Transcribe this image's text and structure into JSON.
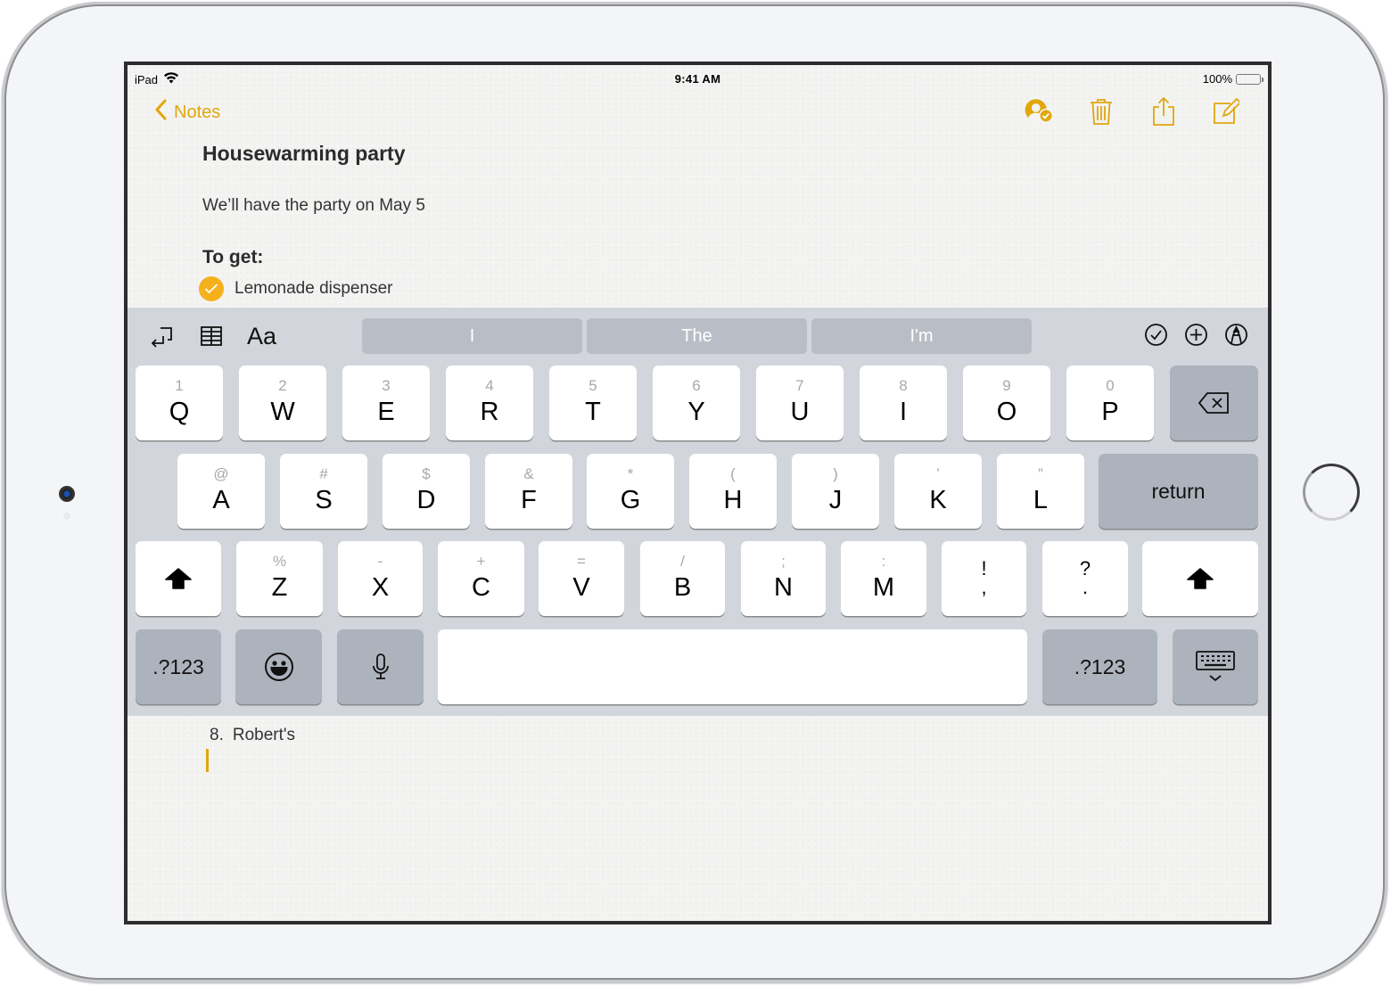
{
  "status_bar": {
    "device": "iPad",
    "time": "9:41 AM",
    "battery": "100%",
    "battery_level": 1.0
  },
  "nav": {
    "back_label": "Notes",
    "icons": [
      "collaborator-icon",
      "trash-icon",
      "share-icon",
      "compose-icon"
    ]
  },
  "note": {
    "title": "Housewarming party",
    "body": "We’ll have the party on May 5",
    "heading": "To get:",
    "checklist": [
      {
        "label": "Lemonade dispenser",
        "checked": true
      }
    ],
    "list_item": {
      "number": "8.",
      "text": "Robert's"
    }
  },
  "keyboard": {
    "toolbar": {
      "left_icons": [
        "undo-icon",
        "table-icon"
      ],
      "format_label": "Aa",
      "suggestions": [
        "I",
        "The",
        "I'm"
      ],
      "right_icons": [
        "checklist-icon",
        "add-icon",
        "markup-icon"
      ]
    },
    "row1": [
      {
        "alt": "1",
        "main": "Q"
      },
      {
        "alt": "2",
        "main": "W"
      },
      {
        "alt": "3",
        "main": "E"
      },
      {
        "alt": "4",
        "main": "R"
      },
      {
        "alt": "5",
        "main": "T"
      },
      {
        "alt": "6",
        "main": "Y"
      },
      {
        "alt": "7",
        "main": "U"
      },
      {
        "alt": "8",
        "main": "I"
      },
      {
        "alt": "9",
        "main": "O"
      },
      {
        "alt": "0",
        "main": "P"
      }
    ],
    "row2": [
      {
        "alt": "@",
        "main": "A"
      },
      {
        "alt": "#",
        "main": "S"
      },
      {
        "alt": "$",
        "main": "D"
      },
      {
        "alt": "&",
        "main": "F"
      },
      {
        "alt": "*",
        "main": "G"
      },
      {
        "alt": "(",
        "main": "H"
      },
      {
        "alt": ")",
        "main": "J"
      },
      {
        "alt": "’",
        "main": "K"
      },
      {
        "alt": "”",
        "main": "L"
      }
    ],
    "row3": [
      {
        "alt": "%",
        "main": "Z"
      },
      {
        "alt": "-",
        "main": "X"
      },
      {
        "alt": "+",
        "main": "C"
      },
      {
        "alt": "=",
        "main": "V"
      },
      {
        "alt": "/",
        "main": "B"
      },
      {
        "alt": ";",
        "main": "N"
      },
      {
        "alt": ":",
        "main": "M"
      }
    ],
    "punct": [
      {
        "top": "!",
        "bottom": ","
      },
      {
        "top": "?",
        "bottom": "."
      }
    ],
    "return_label": "return",
    "numbers_label": ".?123"
  }
}
